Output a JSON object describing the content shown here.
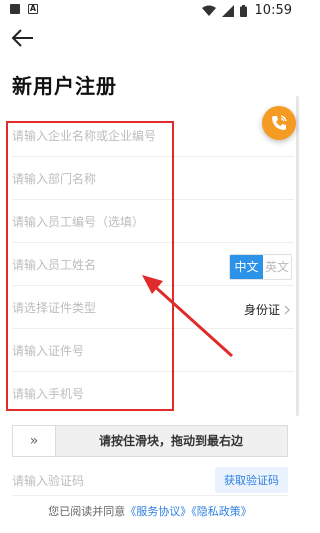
{
  "status_bar": {
    "time": "10:59"
  },
  "header": {
    "title": "新用户注册"
  },
  "form": {
    "company_placeholder": "请输入企业名称或企业编号",
    "department_placeholder": "请输入部门名称",
    "employee_no_placeholder": "请输入员工编号（选填）",
    "employee_name_placeholder": "请输入员工姓名",
    "lang_cn": "中文",
    "lang_en": "英文",
    "id_type_placeholder": "请选择证件类型",
    "id_type_value": "身份证",
    "id_number_placeholder": "请输入证件号",
    "phone_placeholder": "请输入手机号"
  },
  "slider": {
    "label": "请按住滑块，拖动到最右边",
    "handle_glyph": "»"
  },
  "verification": {
    "placeholder": "请输入验证码",
    "get_code": "获取验证码"
  },
  "agreement": {
    "prefix": "您已阅读并同意",
    "service": "《服务协议》",
    "privacy": "《隐私政策》"
  },
  "colors": {
    "accent": "#2c93e8",
    "fab": "#f59a23",
    "annotation": "#e02b2b"
  },
  "icons": [
    "back-arrow-icon",
    "phone-icon",
    "chevron-right-icon",
    "wifi-icon",
    "signal-icon",
    "battery-icon"
  ]
}
